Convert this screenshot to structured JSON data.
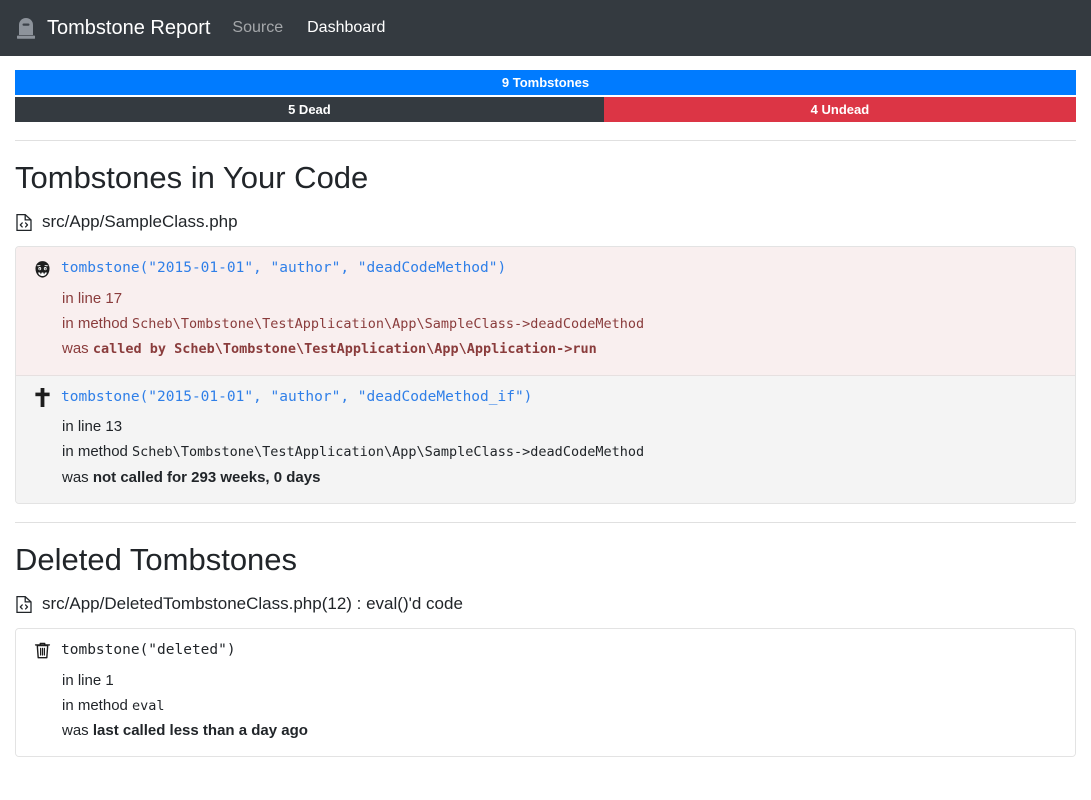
{
  "navbar": {
    "brand": "Tombstone Report",
    "brand_icon": "tombstone-icon",
    "links": [
      {
        "label": "Source",
        "active": false
      },
      {
        "label": "Dashboard",
        "active": true
      }
    ]
  },
  "stats": {
    "total": {
      "label": "9 Tombstones",
      "count": 9,
      "color": "#007bff",
      "width_pct": 100
    },
    "dead": {
      "label": "5 Dead",
      "count": 5,
      "color": "#343a40",
      "width_pct": 55.5
    },
    "undead": {
      "label": "4 Undead",
      "count": 4,
      "color": "#dc3545",
      "width_pct": 44.5
    }
  },
  "sections": [
    {
      "title": "Tombstones in Your Code",
      "file": "src/App/SampleClass.php",
      "file_icon": "file-code-icon",
      "items": [
        {
          "icon": "vampire-icon",
          "tone": "red",
          "background": "#f9efef",
          "code": "tombstone(\"2015-01-01\", \"author\", \"deadCodeMethod\")",
          "code_color": "blue",
          "line": "in line 17",
          "method_prefix": "in method ",
          "method": "Scheb\\Tombstone\\TestApplication\\App\\SampleClass->deadCodeMethod",
          "status_prefix": "was ",
          "status_bold": "called by Scheb\\Tombstone\\TestApplication\\App\\Application->run"
        },
        {
          "icon": "cross-icon",
          "tone": "dark",
          "background": "#f4f4f4",
          "code": "tombstone(\"2015-01-01\", \"author\", \"deadCodeMethod_if\")",
          "code_color": "blue",
          "line": "in line 13",
          "method_prefix": "in method ",
          "method": "Scheb\\Tombstone\\TestApplication\\App\\SampleClass->deadCodeMethod",
          "status_prefix": "was ",
          "status_bold": "not called for 293 weeks, 0 days"
        }
      ]
    },
    {
      "title": "Deleted Tombstones",
      "file": "src/App/DeletedTombstoneClass.php(12) : eval()'d code",
      "file_icon": "file-code-icon",
      "items": [
        {
          "icon": "trash-icon",
          "tone": "dark",
          "background": "#ffffff",
          "code": "tombstone(\"deleted\")",
          "code_color": "dark",
          "line": "in line 1",
          "method_prefix": "in method ",
          "method": "eval",
          "status_prefix": "was ",
          "status_bold": "last called less than a day ago"
        }
      ]
    }
  ]
}
